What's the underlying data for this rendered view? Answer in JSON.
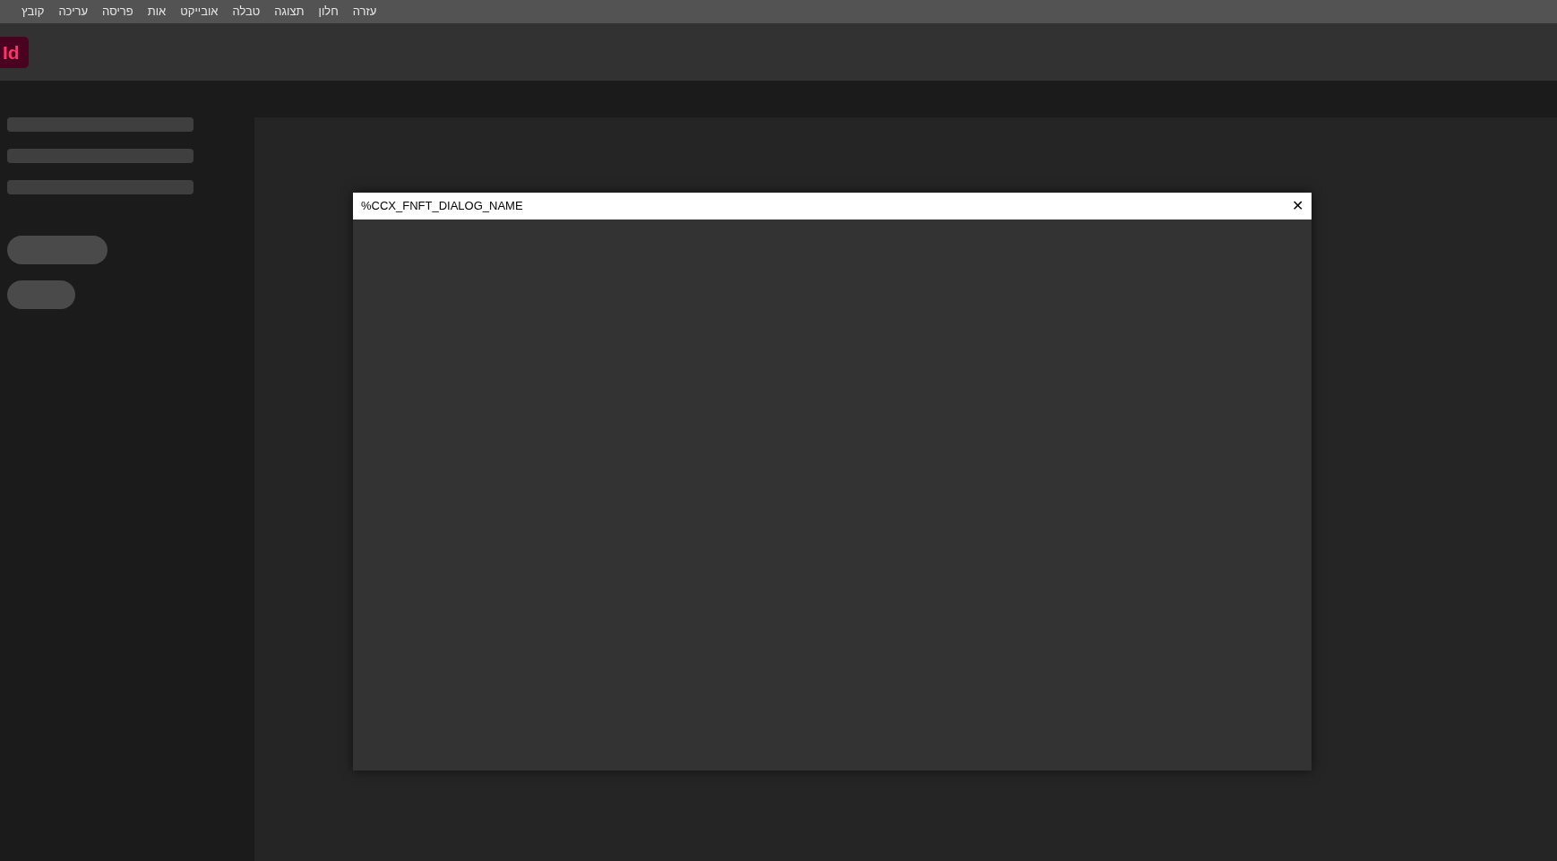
{
  "menu_bar": [
    "עזרה",
    "חלון",
    "תצוגה",
    "טבלה",
    "אובייקט",
    "אות",
    "פריסה",
    "עריכה",
    "קובץ"
  ],
  "app_logo": {
    "text": "Id"
  },
  "dialog": {
    "title": "%CCX_FNFT_DIALOG_NAME",
    "close": "✕"
  }
}
